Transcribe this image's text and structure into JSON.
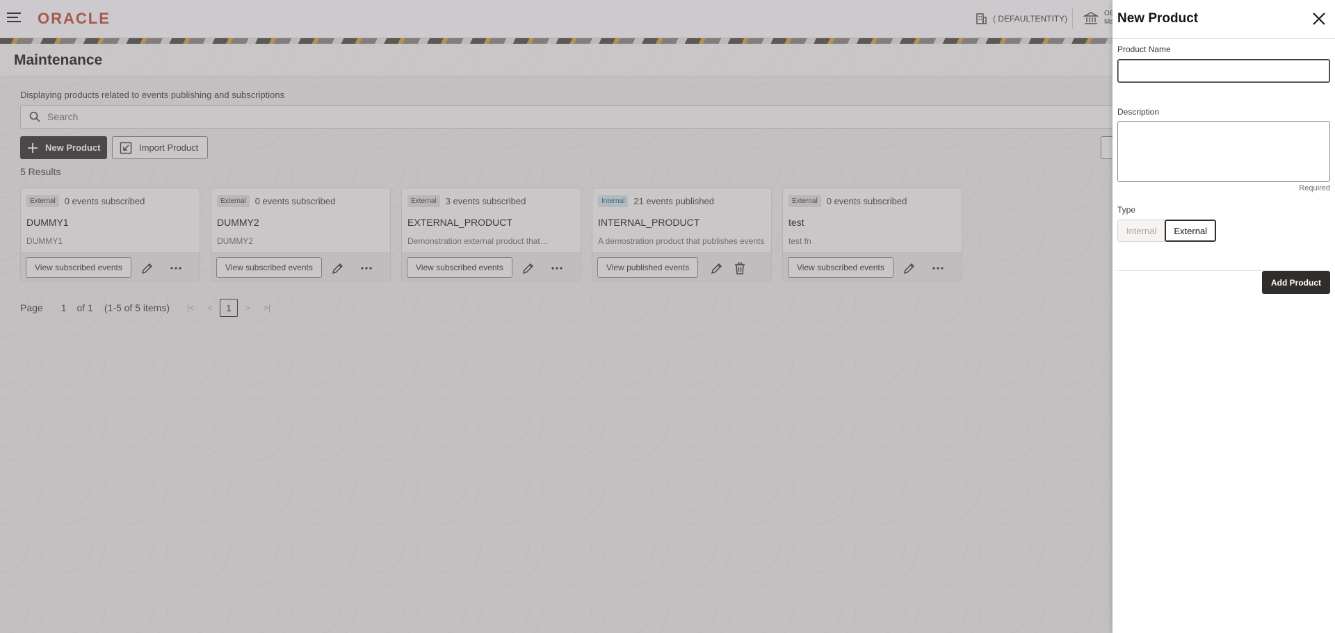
{
  "header": {
    "logo": "ORACLE",
    "entity": "( DEFAULTENTITY)",
    "bank_line1": "OB",
    "bank_line2": "Ma"
  },
  "page": {
    "title": "Maintenance",
    "subtitle": "Displaying products related to events publishing and subscriptions",
    "search_placeholder": "Search",
    "new_product_label": "New Product",
    "import_product_label": "Import Product",
    "results": "5 Results"
  },
  "cards": [
    {
      "badge": "External",
      "count": "0 events subscribed",
      "name": "DUMMY1",
      "desc": "DUMMY1",
      "action": "View subscribed events"
    },
    {
      "badge": "External",
      "count": "0 events subscribed",
      "name": "DUMMY2",
      "desc": "DUMMY2",
      "action": "View subscribed events"
    },
    {
      "badge": "External",
      "count": "3 events subscribed",
      "name": "EXTERNAL_PRODUCT",
      "desc": "Demonstration external product that…",
      "action": "View subscribed events"
    },
    {
      "badge": "Internal",
      "count": "21 events published",
      "name": "INTERNAL_PRODUCT",
      "desc": "A demostration product that publishes events",
      "action": "View published events"
    },
    {
      "badge": "External",
      "count": "0 events subscribed",
      "name": "test",
      "desc": "test fn",
      "action": "View subscribed events"
    }
  ],
  "pager": {
    "page_label": "Page",
    "page_input": "1",
    "of_label": "of 1",
    "range": "(1-5 of 5 items)",
    "current": "1"
  },
  "drawer": {
    "title": "New Product",
    "name_label": "Product Name",
    "name_value": "",
    "desc_label": "Description",
    "required": "Required",
    "type_label": "Type",
    "type_internal": "Internal",
    "type_external": "External",
    "type_selected": "External",
    "add_label": "Add Product"
  },
  "colors": {
    "brand": "#c74634",
    "primary_button": "#312d2a",
    "internal_badge": "#d4e6ed"
  }
}
